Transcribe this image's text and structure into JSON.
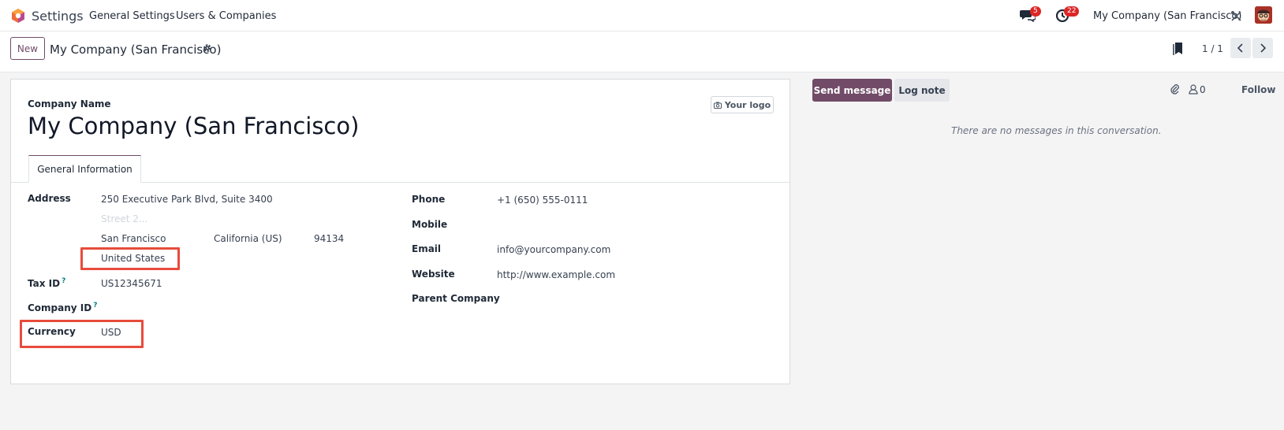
{
  "navbar": {
    "app_name": "Settings",
    "menu": [
      "General Settings",
      "Users & Companies"
    ],
    "messages_count": "5",
    "activities_count": "22",
    "company": "My Company (San Francisco)"
  },
  "control_panel": {
    "new_label": "New",
    "record_title": "My Company (San Francisco)",
    "pager": "1 / 1"
  },
  "form": {
    "company_name_label": "Company Name",
    "company_name": "My Company (San Francisco)",
    "logo_button": "Your logo",
    "tab_label": "General Information",
    "address_label": "Address",
    "street": "250 Executive Park Blvd, Suite 3400",
    "street2_placeholder": "Street 2...",
    "city": "San Francisco",
    "state": "California (US)",
    "zip": "94134",
    "country": "United States",
    "tax_id_label": "Tax ID",
    "tax_id": "US12345671",
    "company_id_label": "Company ID",
    "currency_label": "Currency",
    "currency": "USD",
    "phone_label": "Phone",
    "phone": "+1 (650) 555-0111",
    "mobile_label": "Mobile",
    "email_label": "Email",
    "email": "info@yourcompany.com",
    "website_label": "Website",
    "website": "http://www.example.com",
    "parent_company_label": "Parent Company",
    "help_mark": "?"
  },
  "chatter": {
    "send_message": "Send message",
    "log_note": "Log note",
    "followers_count": "0",
    "follow_label": "Follow",
    "empty_text": "There are no messages in this conversation."
  },
  "colors": {
    "brand": "#714b67",
    "highlight": "#e74c3c",
    "badge": "#dc2626"
  }
}
